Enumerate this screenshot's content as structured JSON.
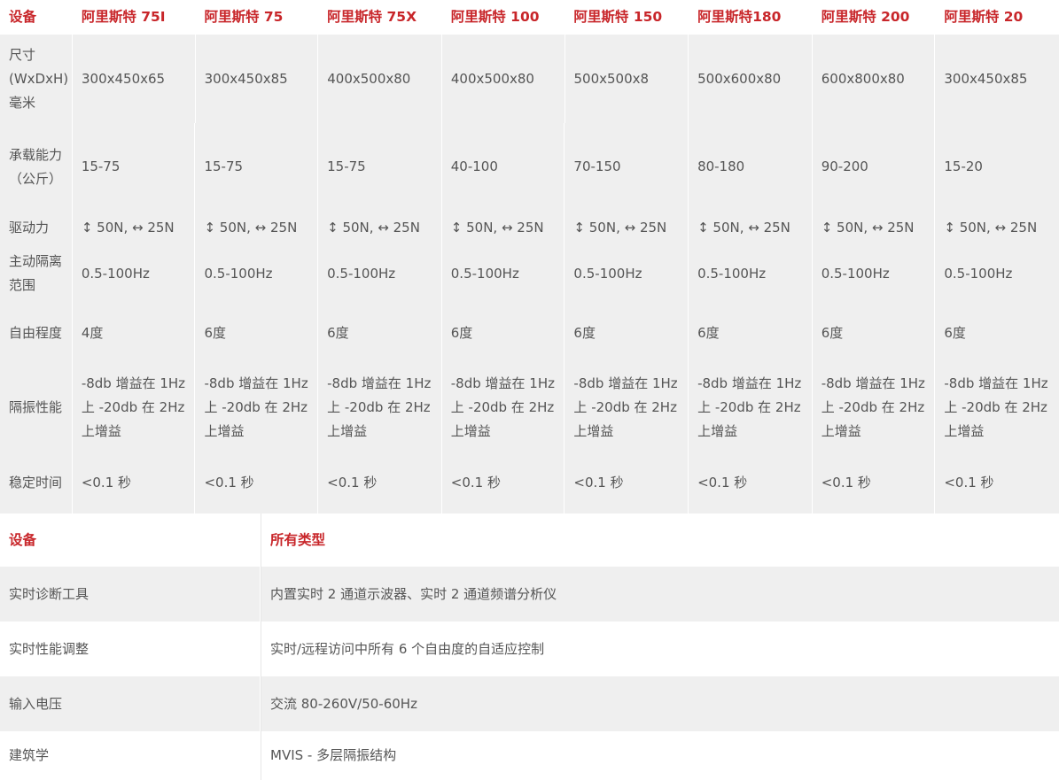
{
  "spec_table": {
    "header": [
      "设备",
      "阿里斯特 75I",
      "阿里斯特 75",
      "阿里斯特 75X",
      "阿里斯特 100",
      "阿里斯特 150",
      "阿里斯特180",
      "阿里斯特 200",
      "阿里斯特 20"
    ],
    "rows": [
      {
        "label": "尺寸(WxDxH) 毫米",
        "values": [
          "300x450x65",
          "300x450x85",
          "400x500x80",
          "400x500x80",
          "500x500x8",
          "500x600x80",
          "600x800x80",
          "300x450x85"
        ]
      },
      {
        "label": "承载能力（公斤）",
        "values": [
          "15-75",
          "15-75",
          "15-75",
          "40-100",
          "70-150",
          "80-180",
          "90-200",
          "15-20"
        ]
      },
      {
        "label": "驱动力",
        "values": [
          "↕ 50N, ↔ 25N",
          "↕ 50N, ↔ 25N",
          "↕ 50N, ↔ 25N",
          "↕ 50N, ↔ 25N",
          "↕ 50N, ↔ 25N",
          "↕ 50N, ↔ 25N",
          "↕ 50N, ↔ 25N",
          "↕ 50N, ↔ 25N"
        ]
      },
      {
        "label": "主动隔离范围",
        "values": [
          "0.5-100Hz",
          "0.5-100Hz",
          "0.5-100Hz",
          "0.5-100Hz",
          "0.5-100Hz",
          "0.5-100Hz",
          "0.5-100Hz",
          "0.5-100Hz"
        ]
      },
      {
        "label": "自由程度",
        "values": [
          "4度",
          "6度",
          "6度",
          "6度",
          "6度",
          "6度",
          "6度",
          "6度"
        ]
      },
      {
        "label": "隔振性能",
        "values": [
          "-8db 增益在 1Hz 上 -20db 在 2Hz 上增益",
          "-8db 增益在 1Hz 上 -20db 在 2Hz 上增益",
          "-8db 增益在 1Hz 上 -20db 在 2Hz 上增益",
          "-8db 增益在 1Hz 上 -20db 在 2Hz 上增益",
          "-8db 增益在 1Hz 上 -20db 在 2Hz 上增益",
          "-8db 增益在 1Hz 上 -20db 在 2Hz 上增益",
          "-8db 增益在 1Hz 上 -20db 在 2Hz 上增益",
          "-8db 增益在 1Hz 上 -20db 在 2Hz 上增益"
        ]
      },
      {
        "label": "稳定时间",
        "values": [
          "<0.1 秒",
          "<0.1 秒",
          "<0.1 秒",
          "<0.1 秒",
          "<0.1 秒",
          "<0.1 秒",
          "<0.1 秒",
          "<0.1 秒"
        ]
      }
    ]
  },
  "feature_table": {
    "header": [
      "设备",
      "所有类型"
    ],
    "rows": [
      [
        "实时诊断工具",
        "内置实时 2 通道示波器、实时 2 通道频谱分析仪"
      ],
      [
        "实时性能调整",
        "实时/远程访问中所有 6 个自由度的自适应控制"
      ],
      [
        "输入电压",
        "交流 80-260V/50-60Hz"
      ],
      [
        "建筑学",
        "MVIS - 多层隔振结构"
      ]
    ]
  },
  "colors": {
    "accent": "#c8262a",
    "row_gray": "#efefef",
    "text": "#555555"
  }
}
